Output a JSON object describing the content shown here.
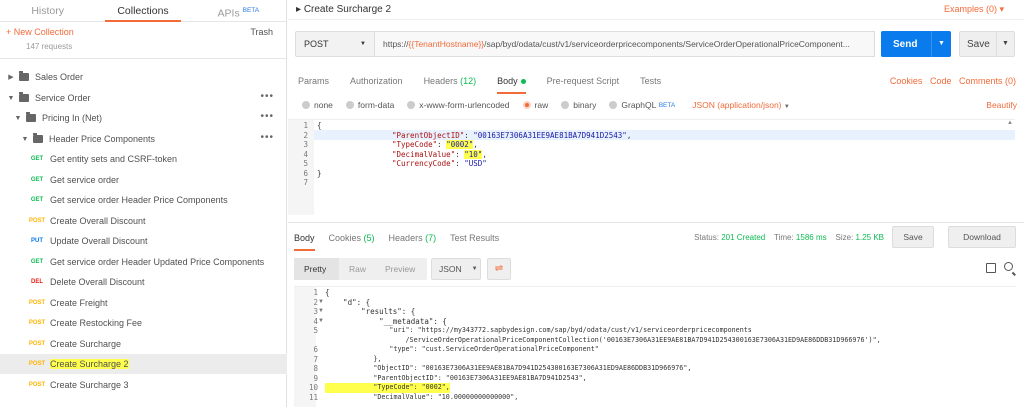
{
  "sidebar": {
    "tabs": [
      {
        "label": "History"
      },
      {
        "label": "Collections"
      },
      {
        "label": "APIs",
        "badge": "BETA"
      }
    ],
    "new_collection": "+ New Collection",
    "trash": "Trash",
    "request_count": "147 requests",
    "folders": [
      {
        "label": "Sales Order"
      },
      {
        "label": "Service Order"
      },
      {
        "label": "Pricing In (Net)"
      },
      {
        "label": "Header Price Components"
      }
    ],
    "requests": [
      {
        "method": "GET",
        "label": "Get entity sets and CSRF-token"
      },
      {
        "method": "GET",
        "label": "Get service order"
      },
      {
        "method": "GET",
        "label": "Get service order Header Price Components"
      },
      {
        "method": "POST",
        "label": "Create Overall Discount"
      },
      {
        "method": "PUT",
        "label": "Update Overall Discount"
      },
      {
        "method": "GET",
        "label": "Get service order Header Updated Price Components"
      },
      {
        "method": "DEL",
        "label": "Delete Overall Discount"
      },
      {
        "method": "POST",
        "label": "Create Freight"
      },
      {
        "method": "POST",
        "label": "Create Restocking Fee"
      },
      {
        "method": "POST",
        "label": "Create Surcharge"
      },
      {
        "method": "POST",
        "label": "Create Surcharge 2"
      },
      {
        "method": "POST",
        "label": "Create Surcharge 3"
      }
    ]
  },
  "main": {
    "title": "Create Surcharge 2",
    "examples": "Examples (0)",
    "method": "POST",
    "url_prefix": "https://",
    "url_var": "{{TenantHostname}}",
    "url_rest": "/sap/byd/odata/cust/v1/serviceorderpricecomponents/ServiceOrderOperationalPriceComponent...",
    "send": "Send",
    "save": "Save",
    "tabs": {
      "params": "Params",
      "authorization": "Authorization",
      "headers": "Headers",
      "headers_count": "(12)",
      "body": "Body",
      "prereq": "Pre-request Script",
      "tests": "Tests",
      "cookies": "Cookies",
      "code": "Code",
      "comments": "Comments (0)"
    },
    "body_modes": [
      "none",
      "form-data",
      "x-www-form-urlencoded",
      "raw",
      "binary",
      "GraphQL"
    ],
    "graphql_badge": "BETA",
    "json_type": "JSON (application/json)",
    "beautify": "Beautify",
    "request_body": [
      {
        "n": "1",
        "text": "{"
      },
      {
        "n": "2",
        "k": "\"ParentObjectID\"",
        "v": "\"00163E7306A31EE9AE81BA7D941D2543\"",
        "end": ","
      },
      {
        "n": "3",
        "k": "\"TypeCode\"",
        "v": "\"0002\"",
        "end": ","
      },
      {
        "n": "4",
        "k": "\"DecimalValue\"",
        "v": "\"10\"",
        "end": ","
      },
      {
        "n": "5",
        "k": "\"CurrencyCode\"",
        "v": "\"USD\"",
        "end": ""
      },
      {
        "n": "6",
        "text": "}"
      },
      {
        "n": "7",
        "text": ""
      }
    ]
  },
  "response": {
    "tabs": {
      "body": "Body",
      "cookies": "Cookies",
      "cookies_count": "(5)",
      "headers": "Headers",
      "headers_count": "(7)",
      "tests": "Test Results"
    },
    "status_label": "Status:",
    "status": "201 Created",
    "time_label": "Time:",
    "time": "1586 ms",
    "size_label": "Size:",
    "size": "1.25 KB",
    "save": "Save",
    "download": "Download",
    "view_pretty": "Pretty",
    "view_raw": "Raw",
    "view_preview": "Preview",
    "format": "JSON",
    "lines": [
      {
        "n": "1",
        "t": "{"
      },
      {
        "n": "2",
        "t": "    \"d\": {"
      },
      {
        "n": "3",
        "t": "        \"results\": {"
      },
      {
        "n": "4",
        "t": "            \"__metadata\": {"
      },
      {
        "n": "5",
        "t": "                \"uri\": \"https://my343772.sapbydesign.com/sap/byd/odata/cust/v1/serviceorderpricecomponents"
      },
      {
        "n": "",
        "t": "                    /ServiceOrderOperationalPriceComponentCollection('00163E7306A31EE9AE81BA7D941D254300163E7306A31ED9AE86DDB31D966976')\","
      },
      {
        "n": "6",
        "t": "                \"type\": \"cust.ServiceOrderOperationalPriceComponent\""
      },
      {
        "n": "7",
        "t": "            },"
      },
      {
        "n": "8",
        "t": "            \"ObjectID\": \"00163E7306A31EE9AE81BA7D941D254300163E7306A31ED9AE86DDB31D966976\","
      },
      {
        "n": "9",
        "t": "            \"ParentObjectID\": \"00163E7306A31EE9AE81BA7D941D2543\","
      },
      {
        "n": "10",
        "t": "            \"TypeCode\": \"0002\","
      },
      {
        "n": "11",
        "t": "            \"DecimalValue\": \"10.00000000000000\","
      }
    ]
  }
}
